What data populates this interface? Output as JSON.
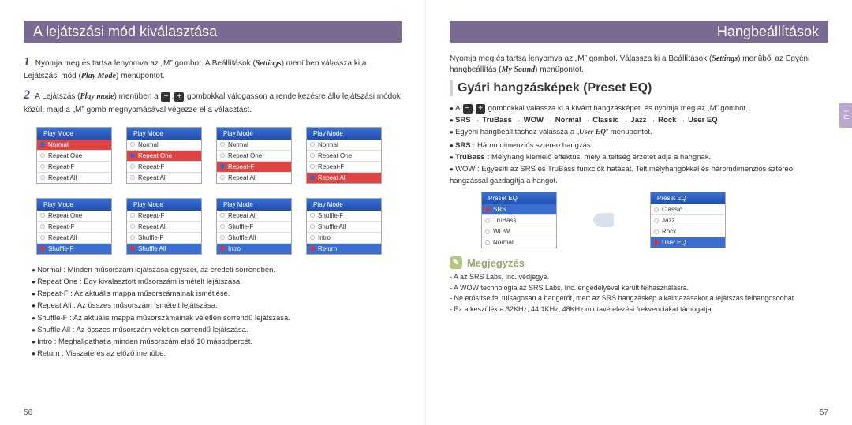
{
  "left": {
    "title": "A lejátszási mód kiválasztása",
    "step1_num": "1",
    "step1_text": "Nyomja meg és tartsa lenyomva az „M” gombot. A Beállítások (",
    "step1_settings": "Settings",
    "step1_text2": ") menüben válassza ki a Lejátszási mód (",
    "step1_playmode": "Play Mode",
    "step1_text3": ") menüpontot.",
    "step2_num": "2",
    "step2_text": "A Lejátszás (",
    "step2_playmode": "Play mode",
    "step2_text2": ") menüben a ",
    "step2_text3": " gombokkal válogasson a rendelkezésre álló lejátszási módok közül, majd a „M” gomb megnyomásával végezze el a választást.",
    "menu_head": "Play Mode",
    "menus": [
      [
        "Normal",
        "Repeat One",
        "Repeat-F",
        "Repeat All"
      ],
      [
        "Normal",
        "Repeat One",
        "Repeat-F",
        "Repeat All"
      ],
      [
        "Normal",
        "Repeat One",
        "Repeat-F",
        "Repeat All"
      ],
      [
        "Normal",
        "Repeat One",
        "Repeat-F",
        "Repeat All"
      ],
      [
        "Repeat One",
        "Repeat-F",
        "Repeat All",
        "Shuffle-F"
      ],
      [
        "Repeat-F",
        "Repeat All",
        "Shuffle-F",
        "Shuffle All"
      ],
      [
        "Repeat All",
        "Shuffle-F",
        "Shuffle All",
        "Intro"
      ],
      [
        "Shuffle-F",
        "Shuffle All",
        "Intro",
        "Return"
      ]
    ],
    "sel": [
      0,
      1,
      2,
      3,
      3,
      3,
      3,
      3
    ],
    "bullets": [
      "Normal : Minden műsorszám lejátszása egyszer, az eredeti sorrendben.",
      "Repeat One : Egy kiválasztott műsorszám ismételt lejátszása.",
      "Repeat-F : Az aktuális mappa műsorszámainak ismétlése.",
      "Repeat All : Az összes műsorszám ismételt lejátszása.",
      "Shuffle-F : Az aktuális mappa műsorszámainak véletlen sorrendű lejátszása.",
      "Shuffle All : Az összes műsorszám véletlen sorrendű lejátszása.",
      "Intro : Meghallgathatja minden műsorszám első 10 másodpercét.",
      "Return : Visszatérés az előző menübe."
    ],
    "page": "56"
  },
  "right": {
    "title": "Hangbeállítások",
    "intro": "Nyomja meg és tartsa lenyomva az „M” gombot. Válassza ki a Beállítások (",
    "intro_settings": "Settings",
    "intro2": ") menüből az Egyéni hangbeállítás (",
    "intro_mysound": "My Sound",
    "intro3": ") menüpontot.",
    "section": "Gyári hangzásképek (Preset EQ)",
    "b1a": "A ",
    "b1b": " gombokkal válassza ki a kívánt hangzásképet, és nyomja meg az „M” gombot.",
    "b2": "SRS → TruBass → WOW →  Normal → Classic → Jazz → Rock → User EQ",
    "b3a": "Egyéni hangbeállításhoz válassza a „",
    "b3_usereq": "User EQ",
    "b3b": "” menüpontot.",
    "b4": "SRS : Háromdimenziós sztereo hangzás.",
    "b5": "TruBass : Mélyhang kiemelő effektus, mely a teltség érzetét adja a hangnak.",
    "b6": "WOW : Egyesíti az SRS és TruBass funkciók hatását. Telt mélyhangokkal és háromdimenziós sztereo hangzással gazdagítja a hangot.",
    "eq_head": "Preset EQ",
    "eq1": [
      "SRS",
      "TruBass",
      "WOW",
      "Normal"
    ],
    "eq2": [
      "Classic",
      "Jazz",
      "Rock",
      "User EQ"
    ],
    "note_hdr": "Megjegyzés",
    "notes": [
      "A           az SRS Labs, Inc. védjegye.",
      "A WOW technológia az SRS Labs, Inc. engedélyével került felhasználásra.",
      "Ne erősítse fel túlságosan a hangerőt, mert az SRS hangzáskép alkalmazásakor a lejátszás felhangosodhat.",
      "Ez a készülék a 32KHz, 44,1KHz, 48KHz mintavételezési frekvenciákat támogatja."
    ],
    "hu": "HU",
    "page": "57"
  }
}
